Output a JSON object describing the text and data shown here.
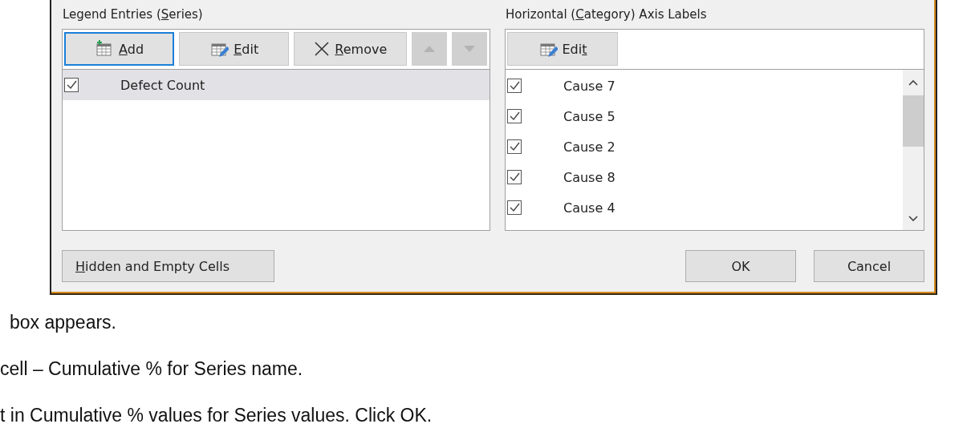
{
  "dialog": {
    "series_panel": {
      "label": {
        "before": "Legend Entries (",
        "key": "S",
        "after": "eries)"
      },
      "buttons": [
        {
          "kind": "add",
          "label": {
            "key": "A",
            "after": "dd"
          },
          "focused": true,
          "disabled": false
        },
        {
          "kind": "edit",
          "label": {
            "key": "E",
            "after": "dit"
          },
          "focused": false,
          "disabled": false
        },
        {
          "kind": "remove",
          "label": {
            "key": "R",
            "after": "emove"
          },
          "focused": false,
          "disabled": false
        },
        {
          "kind": "up",
          "focused": false,
          "disabled": true
        },
        {
          "kind": "down",
          "focused": false,
          "disabled": true
        }
      ],
      "items": [
        {
          "label": "Defect Count",
          "checked": true,
          "selected": true
        }
      ]
    },
    "category_panel": {
      "label": {
        "before": "Horizontal (",
        "key": "C",
        "after": "ategory) Axis Labels"
      },
      "edit_button": {
        "label": {
          "before": "Edi",
          "key": "t"
        }
      },
      "items": [
        {
          "label": "Cause 7",
          "checked": true,
          "selected": false
        },
        {
          "label": "Cause 5",
          "checked": true,
          "selected": false
        },
        {
          "label": "Cause 2",
          "checked": true,
          "selected": false
        },
        {
          "label": "Cause 8",
          "checked": true,
          "selected": false
        },
        {
          "label": "Cause 4",
          "checked": true,
          "selected": false
        }
      ]
    },
    "hidden_cells_button": {
      "label": {
        "key": "H",
        "after": "idden and Empty Cells"
      }
    },
    "ok_button": "OK",
    "cancel_button": "Cancel"
  },
  "body_text": [
    "box appears.",
    "cell – Cumulative % for Series name.",
    "t in Cumulative % values for Series values. Click OK."
  ]
}
